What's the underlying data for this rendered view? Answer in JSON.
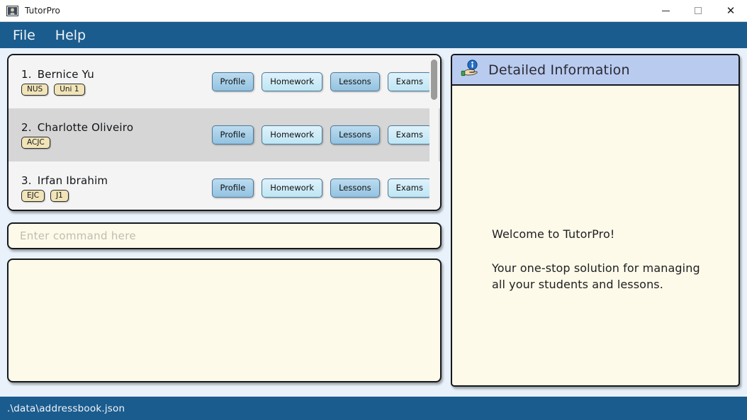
{
  "window": {
    "title": "TutorPro",
    "icon": "tutor-person-icon",
    "controls": {
      "minimize": "minimize-icon",
      "maximize": "maximize-icon",
      "close": "close-icon"
    }
  },
  "menubar": {
    "items": [
      {
        "label": "File"
      },
      {
        "label": "Help"
      }
    ]
  },
  "student_list": {
    "scrollbar": {
      "position": "top"
    },
    "students": [
      {
        "index": "1.",
        "name": "Bernice Yu",
        "tags": [
          "NUS",
          "Uni 1"
        ],
        "selected": false,
        "buttons": [
          {
            "label": "Profile",
            "shade": "dark"
          },
          {
            "label": "Homework",
            "shade": "light"
          },
          {
            "label": "Lessons",
            "shade": "dark"
          },
          {
            "label": "Exams",
            "shade": "light"
          }
        ]
      },
      {
        "index": "2.",
        "name": "Charlotte Oliveiro",
        "tags": [
          "ACJC"
        ],
        "selected": true,
        "buttons": [
          {
            "label": "Profile",
            "shade": "dark"
          },
          {
            "label": "Homework",
            "shade": "light"
          },
          {
            "label": "Lessons",
            "shade": "dark"
          },
          {
            "label": "Exams",
            "shade": "light"
          }
        ]
      },
      {
        "index": "3.",
        "name": "Irfan Ibrahim",
        "tags": [
          "EJC",
          "J1"
        ],
        "selected": false,
        "buttons": [
          {
            "label": "Profile",
            "shade": "dark"
          },
          {
            "label": "Homework",
            "shade": "light"
          },
          {
            "label": "Lessons",
            "shade": "dark"
          },
          {
            "label": "Exams",
            "shade": "light"
          }
        ]
      }
    ]
  },
  "command": {
    "value": "",
    "placeholder": "Enter command here"
  },
  "result": {
    "text": ""
  },
  "detail_panel": {
    "icon": "hand-info-icon",
    "title": "Detailed Information",
    "welcome_heading": "Welcome to TutorPro!",
    "welcome_body": "Your one-stop solution for managing\nall your students and lessons."
  },
  "statusbar": {
    "path": ".\\data\\addressbook.json"
  },
  "colors": {
    "chrome_blue": "#1b5c8e",
    "app_background": "#e9f2fa",
    "panel_cream": "#fdfaea",
    "list_background": "#f4f4f4",
    "row_selected": "#d6d6d6",
    "tag_yellow": "#f0e4b8",
    "detail_header_blue": "#b9cbef",
    "button_dark_blue": "#93c2e0",
    "button_light_blue": "#bfe6f4"
  }
}
